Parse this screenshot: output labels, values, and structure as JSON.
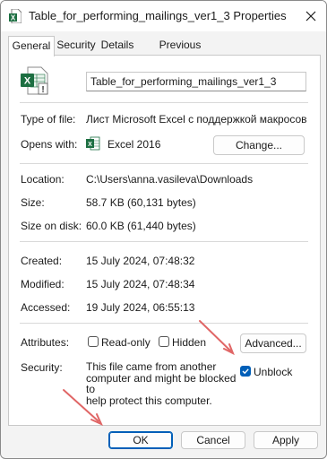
{
  "window": {
    "title": "Table_for_performing_mailings_ver1_3 Properties"
  },
  "tabs": [
    {
      "label": "General"
    },
    {
      "label": "Security"
    },
    {
      "label": "Details"
    },
    {
      "label": "Previous Versions"
    }
  ],
  "file": {
    "name": "Table_for_performing_mailings_ver1_3"
  },
  "general": {
    "type_label": "Type of file:",
    "type_value": "Лист Microsoft Excel с поддержкой макросов (.xls",
    "opens_label": "Opens with:",
    "opens_value": "Excel 2016",
    "change_button": "Change...",
    "location_label": "Location:",
    "location_value": "C:\\Users\\anna.vasileva\\Downloads",
    "size_label": "Size:",
    "size_value": "58.7 KB (60,131 bytes)",
    "size_disk_label": "Size on disk:",
    "size_disk_value": "60.0 KB (61,440 bytes)",
    "created_label": "Created:",
    "created_value": "15 July 2024, 07:48:32",
    "modified_label": "Modified:",
    "modified_value": "15 July 2024, 07:48:34",
    "accessed_label": "Accessed:",
    "accessed_value": "19 July 2024, 06:55:13",
    "attributes_label": "Attributes:",
    "readonly_label": "Read-only",
    "readonly_checked": false,
    "hidden_label": "Hidden",
    "hidden_checked": false,
    "advanced_button": "Advanced...",
    "security_label": "Security:",
    "security_line1": "This file came from another",
    "security_line2": "computer and might be blocked to",
    "security_line3": "help protect this computer.",
    "unblock_label": "Unblock",
    "unblock_checked": true
  },
  "footer": {
    "ok": "OK",
    "cancel": "Cancel",
    "apply": "Apply"
  },
  "colors": {
    "accent": "#005fb8",
    "excel_green": "#1d6f42",
    "annotation_arrow": "#e06666"
  }
}
